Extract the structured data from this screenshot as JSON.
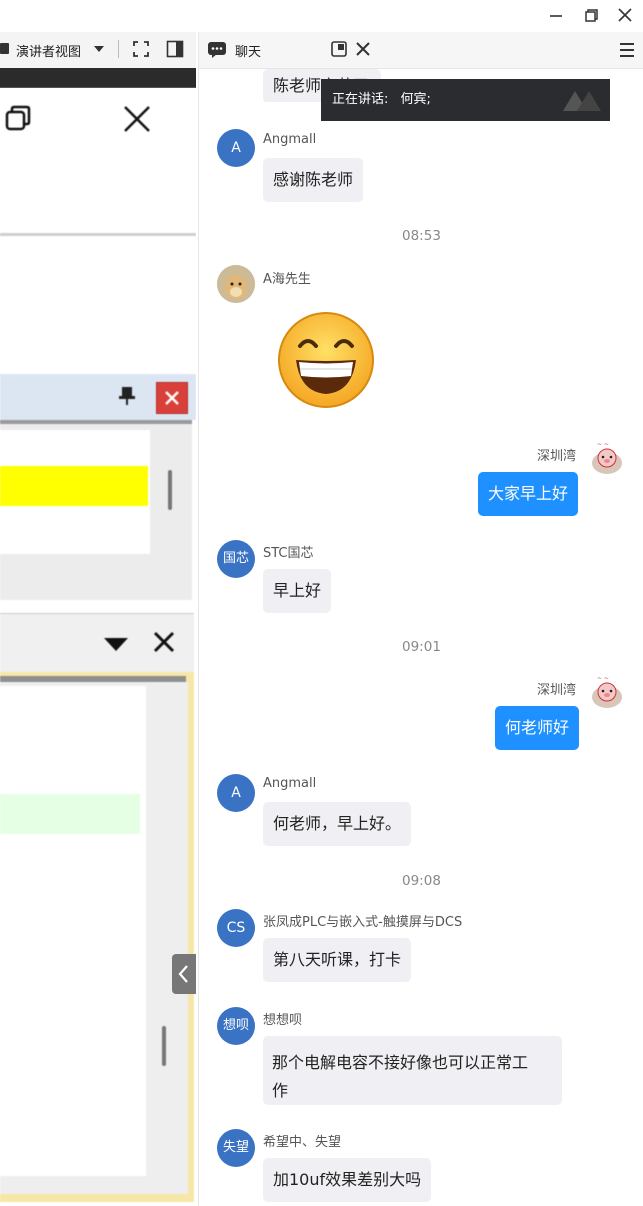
{
  "window": {
    "minimize_icon": "minimize-icon",
    "restore_icon": "restore-icon",
    "close_icon": "close-icon"
  },
  "left_toolbar": {
    "presenter_view_label": "演讲者视图"
  },
  "chat": {
    "title": "聊天",
    "speaking_prefix": "正在讲话:",
    "speaking_name": "何宾;",
    "partial_message": "陈老师辛苦了",
    "messages": [
      {
        "sender": "Angmall",
        "avatar": "A",
        "text": "感谢陈老师"
      },
      {
        "time": "08:53"
      },
      {
        "sender": "A海先生",
        "emoji": "grinning-face"
      },
      {
        "sender": "深圳湾",
        "text": "大家早上好",
        "self": true
      },
      {
        "sender": "STC国芯",
        "avatar": "国芯",
        "text": "早上好"
      },
      {
        "time": "09:01"
      },
      {
        "sender": "深圳湾",
        "text": "何老师好",
        "self": true
      },
      {
        "sender": "Angmall",
        "avatar": "A",
        "text": "何老师，早上好。"
      },
      {
        "time": "09:08"
      },
      {
        "sender": "张凤成PLC与嵌入式-触摸屏与DCS",
        "avatar": "CS",
        "text": "第八天听课，打卡"
      },
      {
        "sender": "想想呗",
        "avatar": "想呗",
        "text_line1": "那个电解电容不接好像也可以正常工",
        "text_line2": "作"
      },
      {
        "sender": "希望中、失望",
        "avatar": "失望",
        "text": "加10uf效果差别大吗"
      }
    ]
  },
  "colors": {
    "self_bubble": "#1e90ff",
    "other_bubble": "#f0f0f4",
    "avatar": "#3a72c4",
    "highlight": "#ffff00"
  }
}
